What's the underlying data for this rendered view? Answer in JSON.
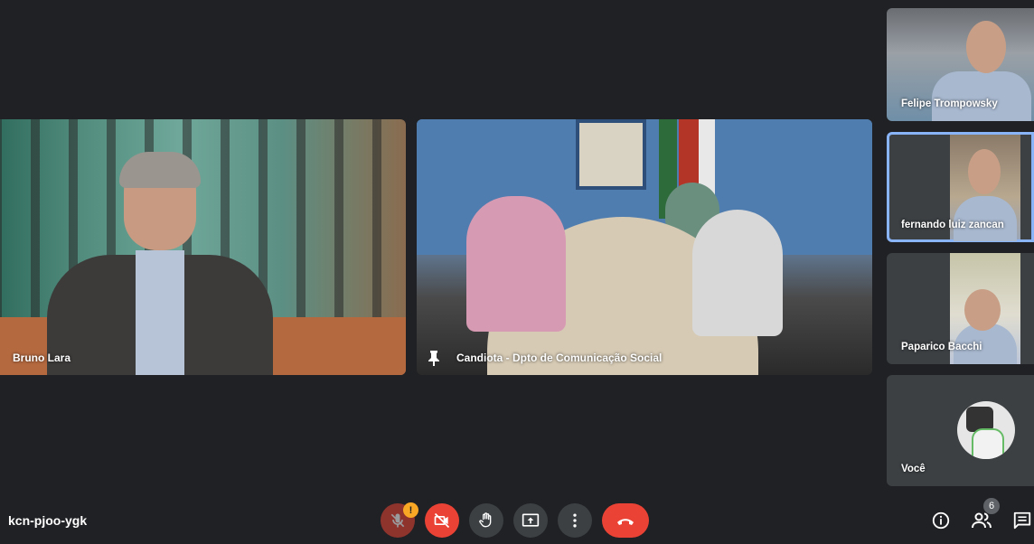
{
  "meeting": {
    "code": "kcn-pjoo-ygk"
  },
  "participants": {
    "main": [
      {
        "name": "Bruno Lara"
      },
      {
        "name": "Candiota - Dpto de Comunicação Social"
      }
    ],
    "side": [
      {
        "name": "Felipe Trompowsky"
      },
      {
        "name": "fernando luiz zancan"
      },
      {
        "name": "Paparico Bacchi"
      },
      {
        "name": "Você"
      }
    ]
  },
  "controls": {
    "mic_icon": "mic-off-icon",
    "mic_warning": "!",
    "camera_icon": "camera-off-icon",
    "hand_icon": "raise-hand-icon",
    "present_icon": "present-screen-icon",
    "more_icon": "more-vert-icon",
    "leave_icon": "hang-up-icon"
  },
  "right_controls": {
    "info_icon": "info-icon",
    "people_icon": "people-icon",
    "people_count": "6",
    "chat_icon": "chat-icon"
  },
  "colors": {
    "background": "#202124",
    "danger": "#ea4335",
    "control_bg": "#3c4043",
    "highlight": "#8ab4f8",
    "warning": "#f9a825"
  }
}
